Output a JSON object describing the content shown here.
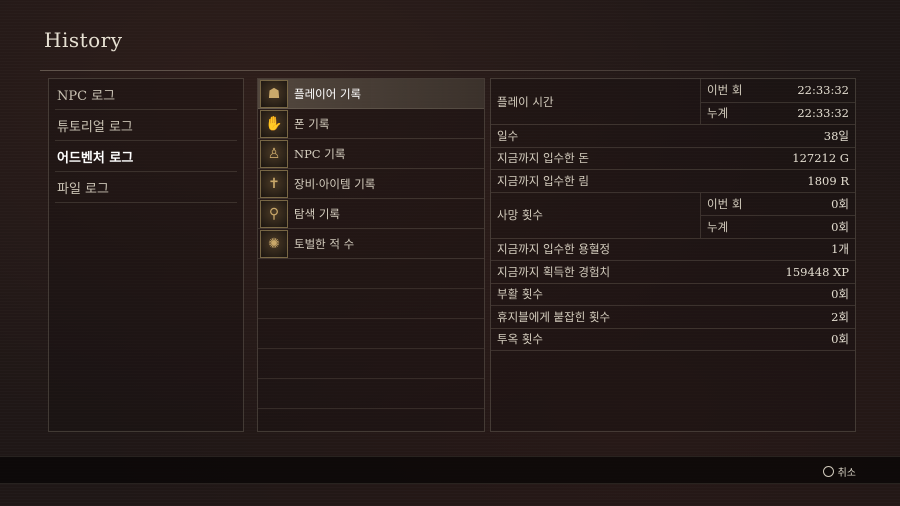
{
  "header": {
    "title": "History"
  },
  "categories": [
    {
      "label": "NPC 로그",
      "active": false
    },
    {
      "label": "튜토리얼 로그",
      "active": false
    },
    {
      "label": "어드벤처 로그",
      "active": true
    },
    {
      "label": "파일 로그",
      "active": false
    }
  ],
  "logs": [
    {
      "label": "플레이어 기록",
      "icon": "player-record-icon",
      "glyph": "☗",
      "active": true
    },
    {
      "label": "폰 기록",
      "icon": "pawn-record-icon",
      "glyph": "✋",
      "active": false
    },
    {
      "label": "NPC 기록",
      "icon": "npc-record-icon",
      "glyph": "♙",
      "active": false
    },
    {
      "label": "장비·아이템 기록",
      "icon": "equipment-record-icon",
      "glyph": "✝",
      "active": false
    },
    {
      "label": "탐색 기록",
      "icon": "exploration-record-icon",
      "glyph": "⚲",
      "active": false
    },
    {
      "label": "토벌한 적 수",
      "icon": "slain-enemies-icon",
      "glyph": "✺",
      "active": false
    }
  ],
  "stats": {
    "play_time": {
      "label": "플레이 시간",
      "current_label": "이번 회",
      "current": "22:33:32",
      "total_label": "누계",
      "total": "22:33:32"
    },
    "days": {
      "label": "일수",
      "value": "38일"
    },
    "gold": {
      "label": "지금까지 입수한 돈",
      "value": "127212 G"
    },
    "rift": {
      "label": "지금까지 입수한 림",
      "value": "1809 R"
    },
    "deaths": {
      "label": "사망 횟수",
      "current_label": "이번 회",
      "current": "0회",
      "total_label": "누계",
      "total": "0회"
    },
    "wyrmslife": {
      "label": "지금까지 입수한 용혈정",
      "value": "1개"
    },
    "xp": {
      "label": "지금까지 획득한 경험치",
      "value": "159448 XP"
    },
    "revives": {
      "label": "부활 횟수",
      "value": "0회"
    },
    "captured": {
      "label": "휴지블에게 붙잡힌 횟수",
      "value": "2회"
    },
    "jailed": {
      "label": "투옥 횟수",
      "value": "0회"
    }
  },
  "footer": {
    "cancel_label": "취소",
    "cancel_icon": "circle-button-icon"
  }
}
